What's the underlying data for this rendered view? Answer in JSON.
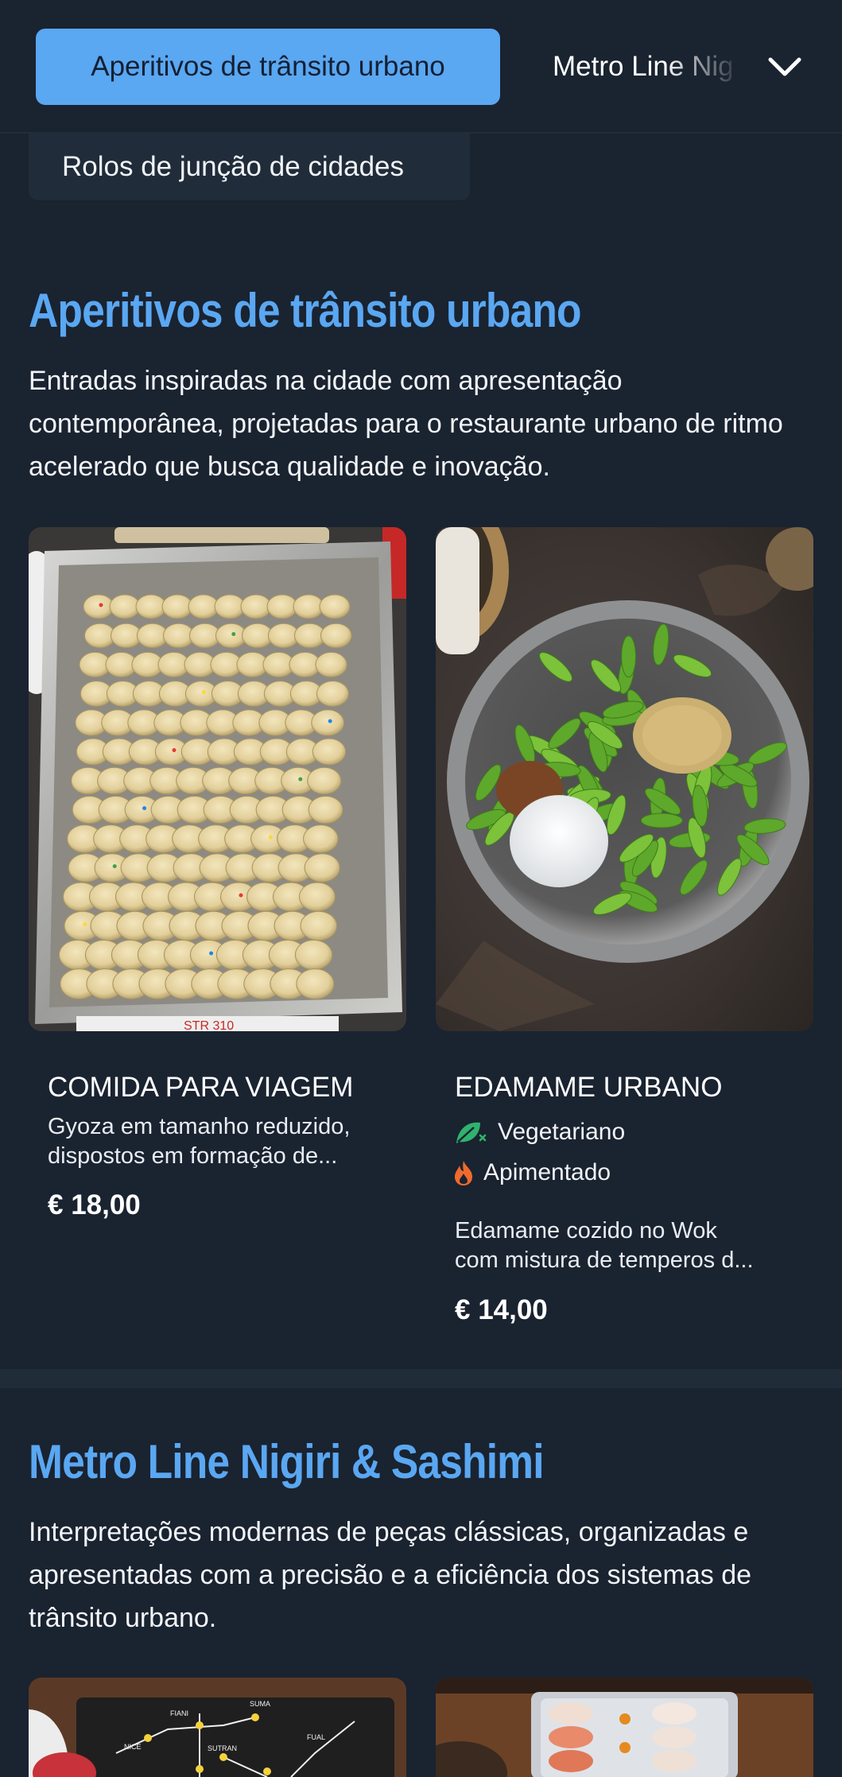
{
  "nav": {
    "active_label": "Aperitivos de trânsito urbano",
    "next_label": "Metro Line Nigiri & Sashimi",
    "sub_label": "Rolos de junção de cidades",
    "toggle_icon": "chevron-down-icon"
  },
  "sections": [
    {
      "title": "Aperitivos de trânsito urbano",
      "description": "Entradas inspiradas na cidade com apresentação contemporânea, projetadas para o restaurante urbano de ritmo acelerado que busca qualidade e inovação.",
      "items": [
        {
          "name": "COMIDA PARA VIAGEM",
          "description_line1": "Gyoza em tamanho reduzido,",
          "description_line2": "dispostos em formação de...",
          "price": "€ 18,00"
        },
        {
          "name": "EDAMAME URBANO",
          "tags": [
            {
              "label": "Vegetariano",
              "icon": "vegetarian-leaf-icon"
            },
            {
              "label": "Apimentado",
              "icon": "spicy-flame-icon"
            }
          ],
          "description_line1": "Edamame cozido no Wok",
          "description_line2": "com mistura de temperos d...",
          "price": "€ 14,00"
        }
      ]
    },
    {
      "title": "Metro Line Nigiri & Sashimi",
      "description": "Interpretações modernas de peças clássicas, organizadas e apresentadas com a precisão e a eficiência dos sistemas de trânsito urbano."
    }
  ],
  "colors": {
    "background": "#1a2330",
    "accent": "#5aa7f2",
    "vegetarian": "#2fb36e",
    "spicy": "#f06a2d"
  }
}
